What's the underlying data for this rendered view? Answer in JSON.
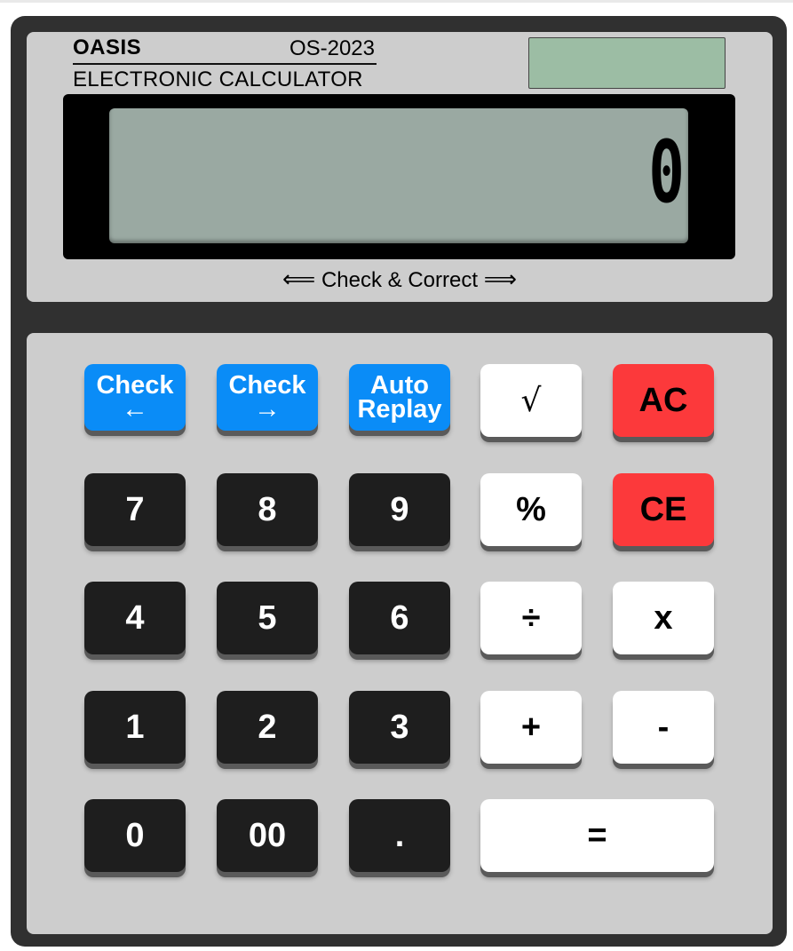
{
  "brand": {
    "name": "OASIS",
    "model": "OS-2023",
    "subtitle": "ELECTRONIC CALCULATOR"
  },
  "display": {
    "value": "0"
  },
  "check_correct": {
    "left_arrow": "⟸",
    "label": "Check & Correct",
    "right_arrow": "⟹"
  },
  "keys": {
    "check_back": {
      "line1": "Check",
      "line2": "←"
    },
    "check_forward": {
      "line1": "Check",
      "line2": "→"
    },
    "auto_replay": {
      "line1": "Auto",
      "line2": "Replay"
    },
    "sqrt": "√",
    "ac": "AC",
    "seven": "7",
    "eight": "8",
    "nine": "9",
    "percent": "%",
    "ce": "CE",
    "four": "4",
    "five": "5",
    "six": "6",
    "divide": "÷",
    "multiply": "x",
    "one": "1",
    "two": "2",
    "three": "3",
    "plus": "+",
    "minus": "-",
    "zero": "0",
    "double_zero": "00",
    "decimal": ".",
    "equals": "="
  },
  "colors": {
    "body": "#303030",
    "panel": "#cdcdcd",
    "lcd": "#9aa9a2",
    "solar_panel": "#9cbda4",
    "digit_key": "#1e1e1e",
    "function_key": "#0a8cf7",
    "clear_key": "#fc393b",
    "operator_key": "#ffffff"
  }
}
